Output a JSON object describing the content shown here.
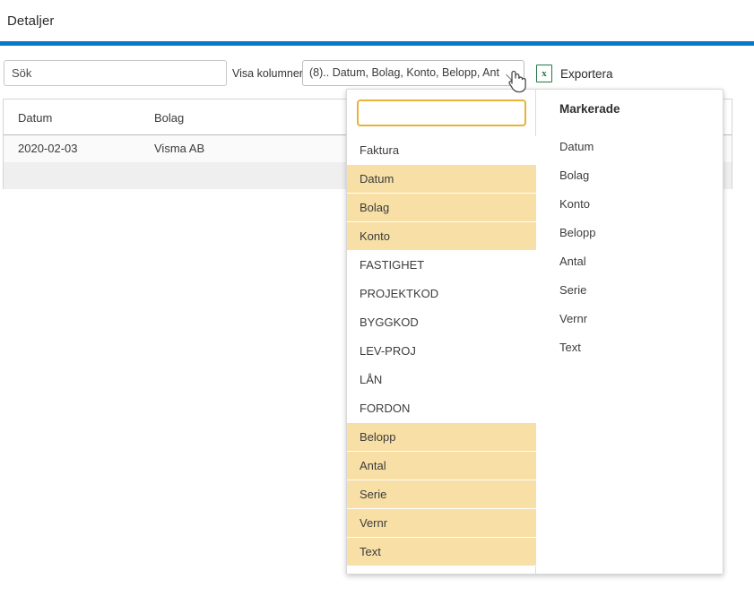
{
  "page": {
    "title": "Detaljer",
    "accent_color": "#0879c8",
    "highlight_color": "#f7dfa5",
    "filter_border_color": "#e8b33b"
  },
  "toolbar": {
    "search_placeholder": "Sök",
    "search_value": "",
    "columns_label": "Visa kolumner",
    "columns_selected_summary": "(8).. Datum, Bolag, Konto, Belopp, Ant...",
    "export_label": "Exportera",
    "export_icon": "excel-x-icon"
  },
  "table": {
    "headers": [
      "Datum",
      "Bolag",
      "",
      ""
    ],
    "rows": [
      {
        "datum": "2020-02-03",
        "bolag": "Visma AB"
      },
      {
        "datum": "",
        "bolag": ""
      }
    ]
  },
  "dropdown": {
    "filter_value": "",
    "filter_placeholder": "",
    "options": [
      {
        "label": "Faktura",
        "selected": false
      },
      {
        "label": "Datum",
        "selected": true
      },
      {
        "label": "Bolag",
        "selected": true
      },
      {
        "label": "Konto",
        "selected": true
      },
      {
        "label": "FASTIGHET",
        "selected": false
      },
      {
        "label": "PROJEKTKOD",
        "selected": false
      },
      {
        "label": "BYGGKOD",
        "selected": false
      },
      {
        "label": "LEV-PROJ",
        "selected": false
      },
      {
        "label": "LÅN",
        "selected": false
      },
      {
        "label": "FORDON",
        "selected": false
      },
      {
        "label": "Belopp",
        "selected": true
      },
      {
        "label": "Antal",
        "selected": true
      },
      {
        "label": "Serie",
        "selected": true
      },
      {
        "label": "Vernr",
        "selected": true
      },
      {
        "label": "Text",
        "selected": true
      }
    ],
    "selected_panel": {
      "title": "Markerade",
      "items": [
        "Datum",
        "Bolag",
        "Konto",
        "Belopp",
        "Antal",
        "Serie",
        "Vernr",
        "Text"
      ]
    }
  },
  "cursor": {
    "type": "pointing-hand-cursor"
  }
}
